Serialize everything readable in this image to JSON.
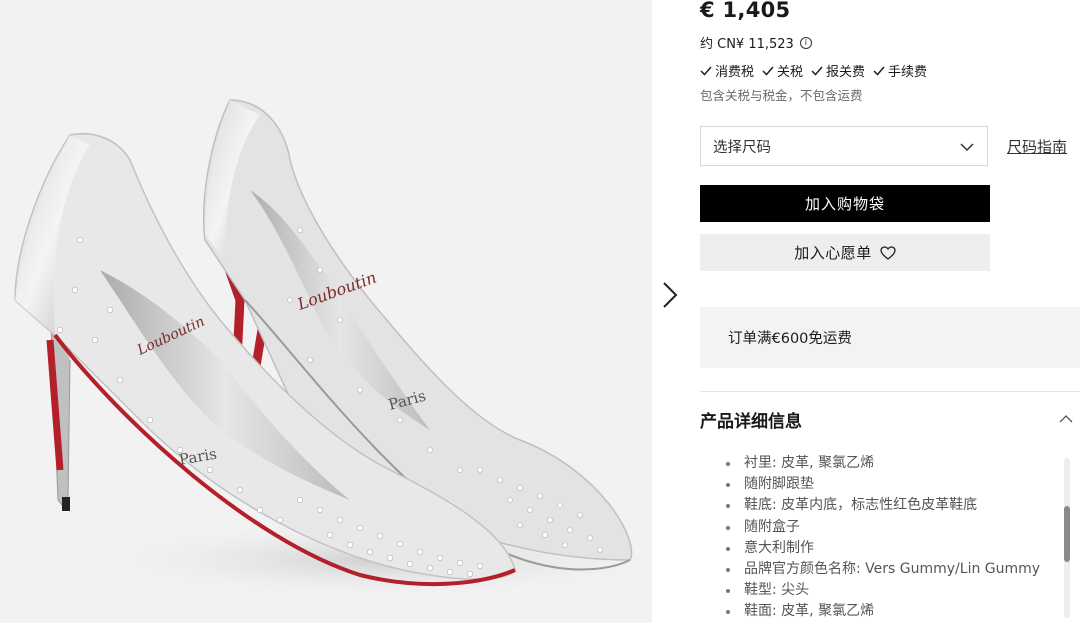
{
  "product": {
    "price": "€ 1,405",
    "approx_price": "约 CN¥ 11,523",
    "info_icon": "i",
    "taxes": [
      "消费税",
      "关税",
      "报关费",
      "手续费"
    ],
    "tax_note": "包含关税与税金，不包含运费",
    "check_icon": "check-icon"
  },
  "image": {
    "brand_script": "Louboutin",
    "brand_city": "Paris"
  },
  "actions": {
    "size_placeholder": "选择尺码",
    "size_guide": "尺码指南",
    "add_to_bag": "加入购物袋",
    "add_to_wishlist": "加入心愿单"
  },
  "shipping": {
    "text": "订单满€600免运费"
  },
  "details": {
    "title": "产品详细信息",
    "items": [
      "衬里: 皮革, 聚氯乙烯",
      "随附脚跟垫",
      "鞋底: 皮革内底，标志性红色皮革鞋底",
      "随附盒子",
      "意大利制作",
      "品牌官方颜色名称: Vers Gummy/Lin Gummy",
      "鞋型: 尖头",
      "鞋面: 皮革, 聚氯乙烯"
    ]
  },
  "colors": {
    "accent": "#000000",
    "sole_red": "#b3202a",
    "muted": "#6b6b6b"
  }
}
